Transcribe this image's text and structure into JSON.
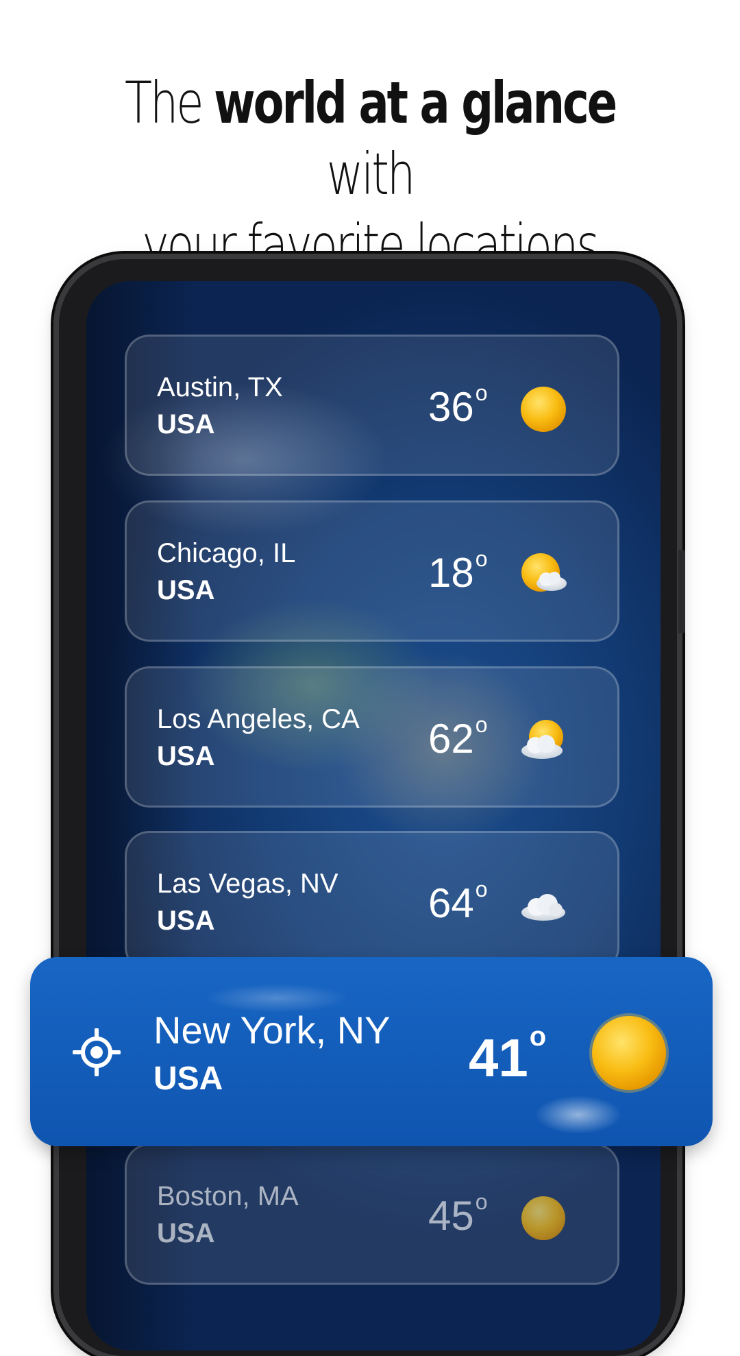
{
  "headline": {
    "part1": "The",
    "bold": "world at a glance",
    "part2": "with",
    "line2": "your favorite locations"
  },
  "locations": [
    {
      "city": "Austin, TX",
      "country": "USA",
      "temp": "36",
      "degree_symbol": "o",
      "condition_icon": "sun-icon"
    },
    {
      "city": "Chicago, IL",
      "country": "USA",
      "temp": "18",
      "degree_symbol": "o",
      "condition_icon": "partly-cloudy-icon"
    },
    {
      "city": "Los Angeles, CA",
      "country": "USA",
      "temp": "62",
      "degree_symbol": "o",
      "condition_icon": "partly-cloudy-icon"
    },
    {
      "city": "Las Vegas, NV",
      "country": "USA",
      "temp": "64",
      "degree_symbol": "o",
      "condition_icon": "cloud-icon"
    },
    {
      "city": "New York, NY",
      "country": "USA",
      "temp": "41",
      "degree_symbol": "o",
      "condition_icon": "sun-icon",
      "current_location": true
    },
    {
      "city": "Boston, MA",
      "country": "USA",
      "temp": "45",
      "degree_symbol": "o",
      "condition_icon": "sun-icon"
    }
  ],
  "colors": {
    "highlight": "#1866c4",
    "sun": "#f7b614",
    "background": "#ffffff"
  }
}
